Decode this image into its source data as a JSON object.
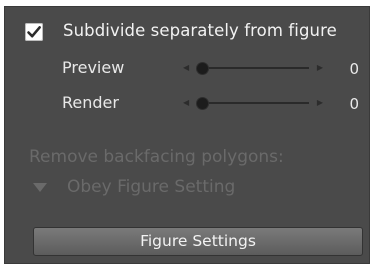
{
  "subdivide": {
    "checked": true,
    "label": "Subdivide separately from figure"
  },
  "preview": {
    "label": "Preview",
    "value": "0",
    "min": 0,
    "level": 0
  },
  "render": {
    "label": "Render",
    "value": "0",
    "min": 0,
    "level": 0
  },
  "backfacing": {
    "label": "Remove backfacing polygons:",
    "selected": "Obey Figure Setting",
    "enabled": false
  },
  "figure_settings_button": "Figure Settings",
  "colors": {
    "panel_bg": "#4a4a4a",
    "text": "#f2f2f2",
    "disabled_text": "#6a6a6a"
  },
  "icons": {
    "checkbox": "checkmark-icon",
    "slider_left": "arrow-left-icon",
    "slider_right": "arrow-right-icon",
    "dropdown": "triangle-down-icon"
  }
}
